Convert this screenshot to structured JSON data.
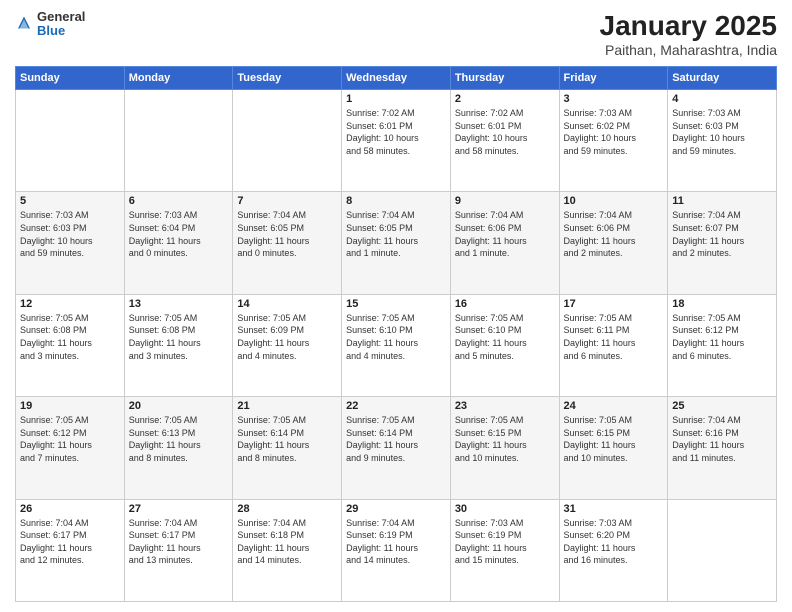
{
  "header": {
    "logo": {
      "general": "General",
      "blue": "Blue"
    },
    "title": "January 2025",
    "subtitle": "Paithan, Maharashtra, India"
  },
  "days_of_week": [
    "Sunday",
    "Monday",
    "Tuesday",
    "Wednesday",
    "Thursday",
    "Friday",
    "Saturday"
  ],
  "weeks": [
    [
      {
        "day": "",
        "info": ""
      },
      {
        "day": "",
        "info": ""
      },
      {
        "day": "",
        "info": ""
      },
      {
        "day": "1",
        "info": "Sunrise: 7:02 AM\nSunset: 6:01 PM\nDaylight: 10 hours\nand 58 minutes."
      },
      {
        "day": "2",
        "info": "Sunrise: 7:02 AM\nSunset: 6:01 PM\nDaylight: 10 hours\nand 58 minutes."
      },
      {
        "day": "3",
        "info": "Sunrise: 7:03 AM\nSunset: 6:02 PM\nDaylight: 10 hours\nand 59 minutes."
      },
      {
        "day": "4",
        "info": "Sunrise: 7:03 AM\nSunset: 6:03 PM\nDaylight: 10 hours\nand 59 minutes."
      }
    ],
    [
      {
        "day": "5",
        "info": "Sunrise: 7:03 AM\nSunset: 6:03 PM\nDaylight: 10 hours\nand 59 minutes."
      },
      {
        "day": "6",
        "info": "Sunrise: 7:03 AM\nSunset: 6:04 PM\nDaylight: 11 hours\nand 0 minutes."
      },
      {
        "day": "7",
        "info": "Sunrise: 7:04 AM\nSunset: 6:05 PM\nDaylight: 11 hours\nand 0 minutes."
      },
      {
        "day": "8",
        "info": "Sunrise: 7:04 AM\nSunset: 6:05 PM\nDaylight: 11 hours\nand 1 minute."
      },
      {
        "day": "9",
        "info": "Sunrise: 7:04 AM\nSunset: 6:06 PM\nDaylight: 11 hours\nand 1 minute."
      },
      {
        "day": "10",
        "info": "Sunrise: 7:04 AM\nSunset: 6:06 PM\nDaylight: 11 hours\nand 2 minutes."
      },
      {
        "day": "11",
        "info": "Sunrise: 7:04 AM\nSunset: 6:07 PM\nDaylight: 11 hours\nand 2 minutes."
      }
    ],
    [
      {
        "day": "12",
        "info": "Sunrise: 7:05 AM\nSunset: 6:08 PM\nDaylight: 11 hours\nand 3 minutes."
      },
      {
        "day": "13",
        "info": "Sunrise: 7:05 AM\nSunset: 6:08 PM\nDaylight: 11 hours\nand 3 minutes."
      },
      {
        "day": "14",
        "info": "Sunrise: 7:05 AM\nSunset: 6:09 PM\nDaylight: 11 hours\nand 4 minutes."
      },
      {
        "day": "15",
        "info": "Sunrise: 7:05 AM\nSunset: 6:10 PM\nDaylight: 11 hours\nand 4 minutes."
      },
      {
        "day": "16",
        "info": "Sunrise: 7:05 AM\nSunset: 6:10 PM\nDaylight: 11 hours\nand 5 minutes."
      },
      {
        "day": "17",
        "info": "Sunrise: 7:05 AM\nSunset: 6:11 PM\nDaylight: 11 hours\nand 6 minutes."
      },
      {
        "day": "18",
        "info": "Sunrise: 7:05 AM\nSunset: 6:12 PM\nDaylight: 11 hours\nand 6 minutes."
      }
    ],
    [
      {
        "day": "19",
        "info": "Sunrise: 7:05 AM\nSunset: 6:12 PM\nDaylight: 11 hours\nand 7 minutes."
      },
      {
        "day": "20",
        "info": "Sunrise: 7:05 AM\nSunset: 6:13 PM\nDaylight: 11 hours\nand 8 minutes."
      },
      {
        "day": "21",
        "info": "Sunrise: 7:05 AM\nSunset: 6:14 PM\nDaylight: 11 hours\nand 8 minutes."
      },
      {
        "day": "22",
        "info": "Sunrise: 7:05 AM\nSunset: 6:14 PM\nDaylight: 11 hours\nand 9 minutes."
      },
      {
        "day": "23",
        "info": "Sunrise: 7:05 AM\nSunset: 6:15 PM\nDaylight: 11 hours\nand 10 minutes."
      },
      {
        "day": "24",
        "info": "Sunrise: 7:05 AM\nSunset: 6:15 PM\nDaylight: 11 hours\nand 10 minutes."
      },
      {
        "day": "25",
        "info": "Sunrise: 7:04 AM\nSunset: 6:16 PM\nDaylight: 11 hours\nand 11 minutes."
      }
    ],
    [
      {
        "day": "26",
        "info": "Sunrise: 7:04 AM\nSunset: 6:17 PM\nDaylight: 11 hours\nand 12 minutes."
      },
      {
        "day": "27",
        "info": "Sunrise: 7:04 AM\nSunset: 6:17 PM\nDaylight: 11 hours\nand 13 minutes."
      },
      {
        "day": "28",
        "info": "Sunrise: 7:04 AM\nSunset: 6:18 PM\nDaylight: 11 hours\nand 14 minutes."
      },
      {
        "day": "29",
        "info": "Sunrise: 7:04 AM\nSunset: 6:19 PM\nDaylight: 11 hours\nand 14 minutes."
      },
      {
        "day": "30",
        "info": "Sunrise: 7:03 AM\nSunset: 6:19 PM\nDaylight: 11 hours\nand 15 minutes."
      },
      {
        "day": "31",
        "info": "Sunrise: 7:03 AM\nSunset: 6:20 PM\nDaylight: 11 hours\nand 16 minutes."
      },
      {
        "day": "",
        "info": ""
      }
    ]
  ]
}
